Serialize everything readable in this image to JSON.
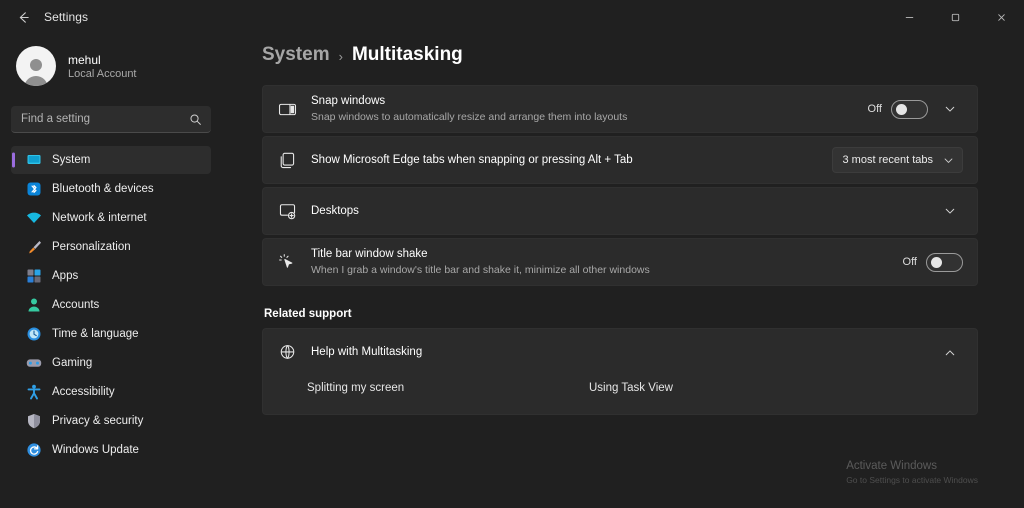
{
  "window": {
    "title": "Settings",
    "back_tooltip": "Back",
    "minimize_label": "Minimize",
    "maximize_label": "Maximize",
    "close_label": "Close"
  },
  "theme": {
    "accent": "#9b6ddf",
    "page_background": "#202020",
    "card_background": "#2b2b2b",
    "selected_nav_background": "#2d2d2d"
  },
  "account": {
    "name": "mehul",
    "type": "Local Account"
  },
  "search": {
    "placeholder": "Find a setting",
    "value": ""
  },
  "sidebar": {
    "items": [
      {
        "label": "System",
        "icon": "monitor-icon",
        "selected": true
      },
      {
        "label": "Bluetooth & devices",
        "icon": "bluetooth-icon",
        "selected": false
      },
      {
        "label": "Network & internet",
        "icon": "wifi-icon",
        "selected": false
      },
      {
        "label": "Personalization",
        "icon": "paintbrush-icon",
        "selected": false
      },
      {
        "label": "Apps",
        "icon": "apps-grid-icon",
        "selected": false
      },
      {
        "label": "Accounts",
        "icon": "person-icon",
        "selected": false
      },
      {
        "label": "Time & language",
        "icon": "clock-globe-icon",
        "selected": false
      },
      {
        "label": "Gaming",
        "icon": "gamepad-icon",
        "selected": false
      },
      {
        "label": "Accessibility",
        "icon": "accessibility-person-icon",
        "selected": false
      },
      {
        "label": "Privacy & security",
        "icon": "shield-icon",
        "selected": false
      },
      {
        "label": "Windows Update",
        "icon": "update-refresh-icon",
        "selected": false
      }
    ]
  },
  "breadcrumb": {
    "parent": "System",
    "separator": "›",
    "current": "Multitasking"
  },
  "settings": [
    {
      "id": "snap-windows",
      "icon": "snap-layout-icon",
      "title": "Snap windows",
      "subtitle": "Snap windows to automatically resize and arrange them into layouts",
      "control": "toggle",
      "toggle_state": "Off",
      "expander": "chevron-down"
    },
    {
      "id": "edge-tabs",
      "icon": "tabs-stack-icon",
      "title": "Show Microsoft Edge tabs when snapping or pressing Alt + Tab",
      "subtitle": "",
      "control": "dropdown",
      "dropdown_value": "3 most recent tabs"
    },
    {
      "id": "desktops",
      "icon": "desktop-add-icon",
      "title": "Desktops",
      "subtitle": "",
      "control": "expander",
      "expander": "chevron-down"
    },
    {
      "id": "title-bar-window-shake",
      "icon": "cursor-shake-icon",
      "title": "Title bar window shake",
      "subtitle": "When I grab a window's title bar and shake it, minimize all other windows",
      "control": "toggle",
      "toggle_state": "Off"
    }
  ],
  "related_support": {
    "section_label": "Related support",
    "help_icon": "help-globe-icon",
    "help_title": "Help with Multitasking",
    "expander": "chevron-up",
    "links": [
      "Splitting my screen",
      "Using Task View"
    ]
  },
  "watermark": {
    "title": "Activate Windows",
    "subtitle": "Go to Settings to activate Windows"
  }
}
